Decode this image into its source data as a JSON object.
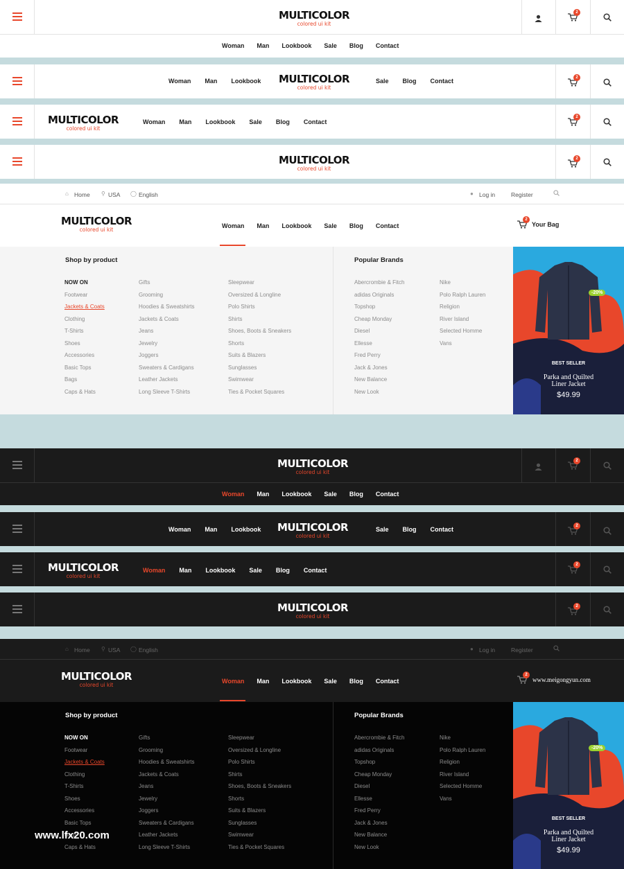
{
  "brand": {
    "name": "MULTICOLOR",
    "tagline": "colored ui kit"
  },
  "colors": {
    "accent": "#e8472b",
    "bg": "#c5dbde",
    "dark_bar": "#1b1b1b",
    "badge_green": "#9bd12e"
  },
  "nav": {
    "woman": "Woman",
    "man": "Man",
    "lookbook": "Lookbook",
    "sale": "Sale",
    "blog": "Blog",
    "contact": "Contact"
  },
  "cart": {
    "count": "2",
    "your_bag": "Your Bag",
    "dark_bag_text": "www.meigongyun.com"
  },
  "topbar": {
    "home": "Home",
    "country": "USA",
    "language": "English",
    "login": "Log in",
    "register": "Register"
  },
  "mega": {
    "shop_heading": "Shop by product",
    "brands_heading": "Popular Brands",
    "col1": [
      "NOW ON",
      "Footwear",
      "Jackets & Coats",
      "Clothing",
      "T-Shirts",
      "Shoes",
      "Accessories",
      "Basic Tops",
      "Bags",
      "Caps & Hats"
    ],
    "col2": [
      "Gifts",
      "Grooming",
      "Hoodies & Sweatshirts",
      "Jackets & Coats",
      "Jeans",
      "Jewelry",
      "Joggers",
      "Sweaters & Cardigans",
      "Leather Jackets",
      "Long Sleeve T-Shirts"
    ],
    "col3": [
      "Sleepwear",
      "Oversized & Longline",
      "Polo Shirts",
      "Shirts",
      "Shoes, Boots & Sneakers",
      "Shorts",
      "Suits & Blazers",
      "Sunglasses",
      "Swimwear",
      "Ties & Pocket Squares"
    ],
    "brands1": [
      "Abercrombie & Fitch",
      "adidas Originals",
      "Topshop",
      "Cheap Monday",
      "Diesel",
      "Ellesse",
      "Fred Perry",
      "Jack & Jones",
      "New Balance",
      "New Look"
    ],
    "brands2": [
      "Nike",
      "Polo Ralph Lauren",
      "Religion",
      "River Island",
      "Selected Homme",
      "Vans"
    ]
  },
  "promo": {
    "discount": "-20%",
    "label": "BEST SELLER",
    "title_line1": "Parka and Quilted",
    "title_line2": "Liner Jacket",
    "price": "$49.99"
  },
  "watermark": "www.lfx20.com"
}
